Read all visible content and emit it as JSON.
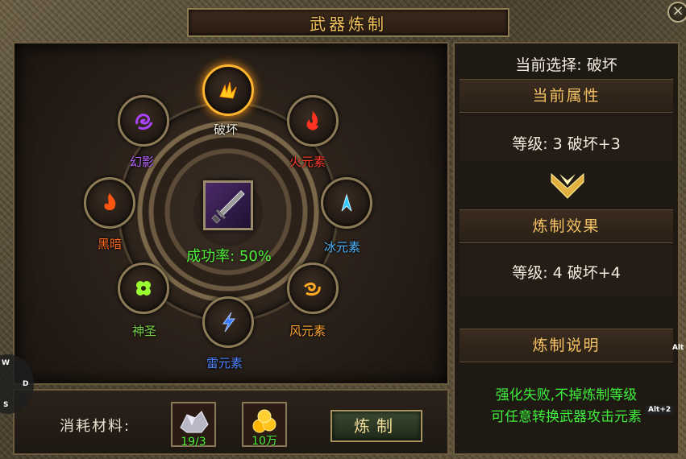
{
  "title": "武器炼制",
  "close_label": "×",
  "center": {
    "success_rate": "成功率: 50%"
  },
  "elements": [
    {
      "key": "destroy",
      "label": "破坏",
      "color": "#f3efe0",
      "icon": "claw-icon",
      "glyph_color": "#ffcc22"
    },
    {
      "key": "fire",
      "label": "火元素",
      "color": "#ff3b2a",
      "icon": "fire-icon",
      "glyph_color": "#ff3322"
    },
    {
      "key": "ice",
      "label": "冰元素",
      "color": "#4fb6ff",
      "icon": "ice-icon",
      "glyph_color": "#33c8ff"
    },
    {
      "key": "wind",
      "label": "风元素",
      "color": "#ffa630",
      "icon": "wind-icon",
      "glyph_color": "#ffaa22"
    },
    {
      "key": "thunder",
      "label": "雷元素",
      "color": "#4f86ff",
      "icon": "lightning-icon",
      "glyph_color": "#3a7aff"
    },
    {
      "key": "holy",
      "label": "神圣",
      "color": "#7dd64a",
      "icon": "holy-icon",
      "glyph_color": "#99ff33"
    },
    {
      "key": "dark",
      "label": "黑暗",
      "color": "#ff6a1f",
      "icon": "dark-flame-icon",
      "glyph_color": "#ff5511"
    },
    {
      "key": "phantom",
      "label": "幻影",
      "color": "#b565ff",
      "icon": "phantom-icon",
      "glyph_color": "#aa44ff"
    }
  ],
  "materials": {
    "label": "消耗材料:",
    "items": [
      {
        "icon": "crystal-ore-icon",
        "count": "19/3"
      },
      {
        "icon": "gold-coins-icon",
        "count": "10万"
      }
    ],
    "button_label": "炼制"
  },
  "right": {
    "current_selection": "当前选择: 破坏",
    "current_attr_title": "当前属性",
    "current_attr_value": "等级: 3  破坏+3",
    "effect_title": "炼制效果",
    "effect_value": "等级: 4  破坏+4",
    "desc_title": "炼制说明",
    "desc_line1": "强化失败,不掉炼制等级",
    "desc_line2": "可任意转换武器攻击元素"
  },
  "side": {
    "w": "W",
    "d": "D",
    "s": "S",
    "alt": "Alt",
    "alt2": "Alt+2"
  }
}
